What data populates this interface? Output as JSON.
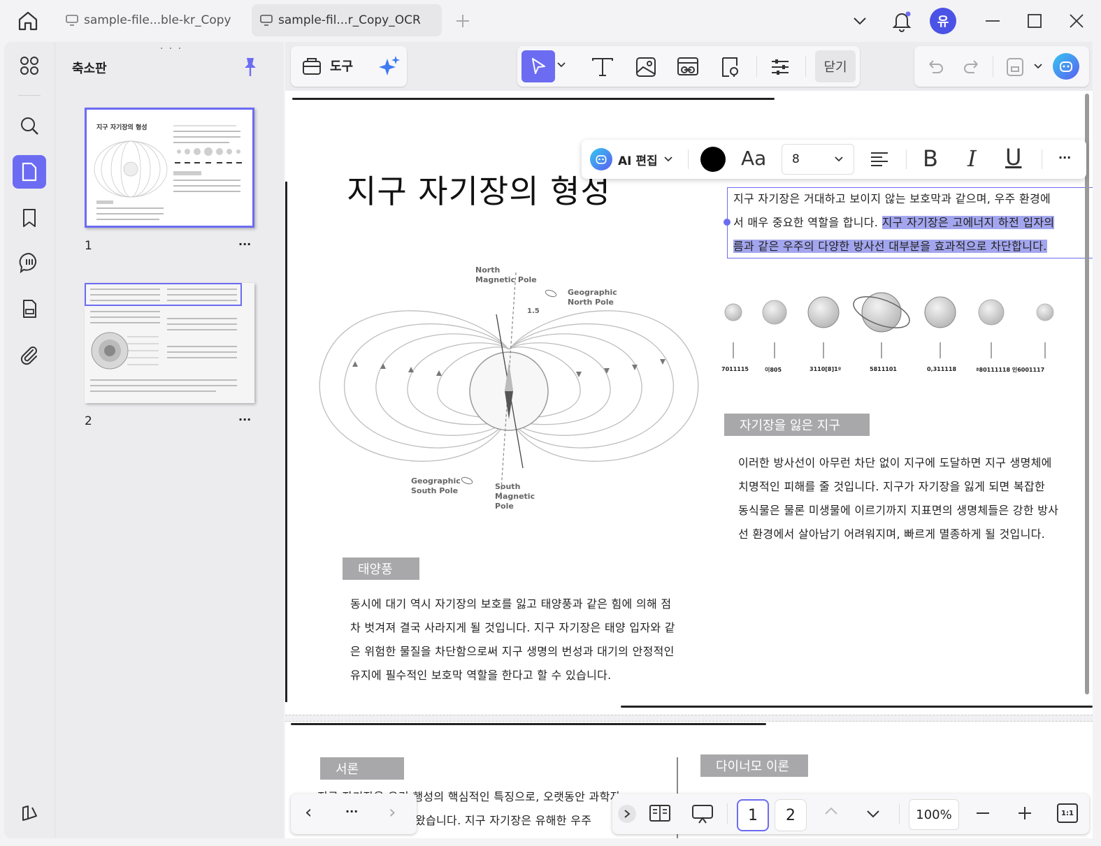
{
  "tabs": [
    {
      "label": "sample-file...ble-kr_Copy",
      "active": false
    },
    {
      "label": "sample-fil...r_Copy_OCR",
      "active": true
    }
  ],
  "user": {
    "avatar_text": "유",
    "avatar_color": "#4b53e6"
  },
  "colors": {
    "accent": "#6c6cf2",
    "highlight": "#a3a6ee"
  },
  "thumbnail_panel": {
    "title": "축소판",
    "pages": [
      {
        "number": "1",
        "mini_title": "지구 자기장의 형성"
      },
      {
        "number": "2"
      }
    ],
    "more": "···"
  },
  "toolbar": {
    "tools_label": "도구",
    "close_label": "닫기"
  },
  "textbar": {
    "ai_label": "AI 편집",
    "font_label": "Aa",
    "font_size": "8",
    "bold": "B",
    "italic": "I",
    "underline": "U",
    "more": "···",
    "color": "#000000"
  },
  "document": {
    "title": "지구 자기장의 형성",
    "intro_line1": "지구 자기장은 거대하고 보이지 않는 보호막과 같으며, 우주 환경에",
    "intro_line2_plain": "서 매우 중요한 역할을 합니다. ",
    "intro_line2_hl": "지구 자기장은 고에너지 하전 입자의",
    "intro_line3_hl": "름과 같은 우주의 다양한 방사선 대부분을 효과적으로 차단합니다.",
    "diagram": {
      "north_magnetic": [
        "North",
        "Magnetic Pole"
      ],
      "geo_north": [
        "Geographic",
        "North Pole"
      ],
      "geo_south": [
        "Geographic",
        "South Pole"
      ],
      "south_magnetic": [
        "South",
        "Magnetic",
        "Pole"
      ],
      "tilt": "1.5"
    },
    "planet_labels": [
      "7011115",
      "이805",
      "3110[8]1º",
      "5811101",
      "0,311118",
      "ª80111118 인6001117"
    ],
    "section_lost": {
      "label": "자기장을 잃은 지구",
      "lines": [
        "이러한 방사선이 아무런 차단 없이 지구에 도달하면 지구 생명체에",
        "치명적인 피해를 줄 것입니다. 지구가 자기장을 잃게 되면 복잡한",
        "동식물은 물론 미생물에 이르기까지 지표면의 생명체들은 강한 방사",
        "선 환경에서 살아남기 어려워지며, 빠르게 멸종하게 될 것입니다."
      ]
    },
    "section_wind": {
      "label": "태양풍",
      "lines": [
        "동시에 대기 역시 자기장의 보호를 잃고 태양풍과 같은 힘에 의해 점",
        "차 벗겨져 결국 사라지게 될 것입니다. 지구 자기장은 태양 입자와 같",
        "은 위험한 물질을 차단함으로써 지구 생명의 번성과 대기의 안정적인",
        "유지에 필수적인 보호막 역할을 한다고 할 수 있습니다."
      ]
    },
    "page2": {
      "intro_label": "서론",
      "dynamo_label": "다이너모 이론",
      "line1": "지구 자기장은 우리 행성의 핵심적인 특징으로, 오랫동안 과학자",
      "line2": "왔습니다. 지구 자기장은 유해한 우주"
    }
  },
  "nav_bar": {
    "prev": "‹",
    "more": "···",
    "next": "›"
  },
  "page_bar": {
    "pages": [
      "1",
      "2"
    ],
    "current": "1",
    "zoom": "100%",
    "fit_label": "1:1"
  }
}
